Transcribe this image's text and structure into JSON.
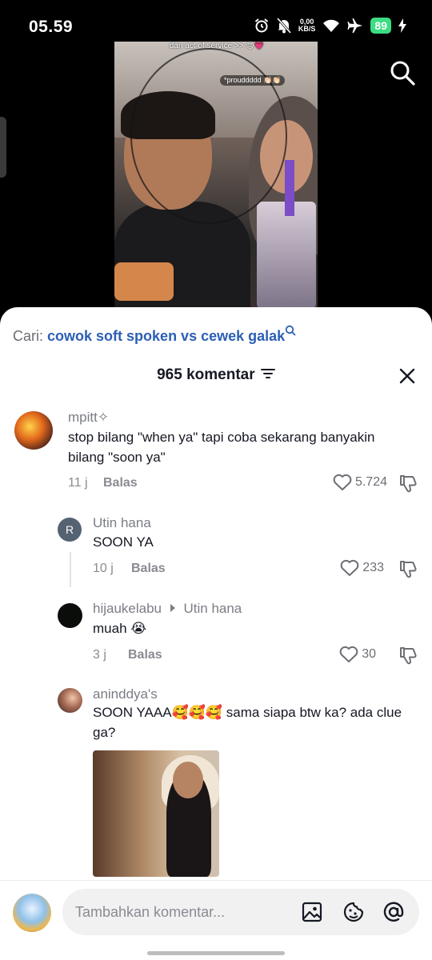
{
  "status_bar": {
    "time": "05.59",
    "net_speed_value": "0,00",
    "net_speed_unit": "KB/S",
    "battery": "89"
  },
  "video": {
    "caption": "dan act of service >> 😊💗",
    "sticker": "*prouddddd 👏🏻👏🏻"
  },
  "search_suggestion": {
    "prefix": "Cari:",
    "query": "cowok soft spoken vs cewek galak"
  },
  "comments_header": {
    "count_label": "965 komentar"
  },
  "comments": [
    {
      "username": "mpitt✧",
      "text": "stop bilang \"when ya\" tapi coba sekarang banyakin bilang \"soon ya\"",
      "time": "11 j",
      "reply_label": "Balas",
      "likes": "5.724"
    },
    {
      "username": "Utin hana",
      "avatar_letter": "R",
      "text": "SOON YA",
      "time": "10 j",
      "reply_label": "Balas",
      "likes": "233"
    },
    {
      "username": "hijaukelabu",
      "reply_to": "Utin hana",
      "text": "muah 😭",
      "time": "3 j",
      "reply_label": "Balas",
      "likes": "30"
    },
    {
      "username": "aninddya's",
      "text": "SOON YAAA🥰🥰🥰 sama siapa btw ka? ada clue ga?"
    }
  ],
  "composer": {
    "placeholder": "Tambahkan komentar..."
  },
  "colors": {
    "accent_link": "#2b5fb4",
    "battery": "#3ddc84"
  }
}
